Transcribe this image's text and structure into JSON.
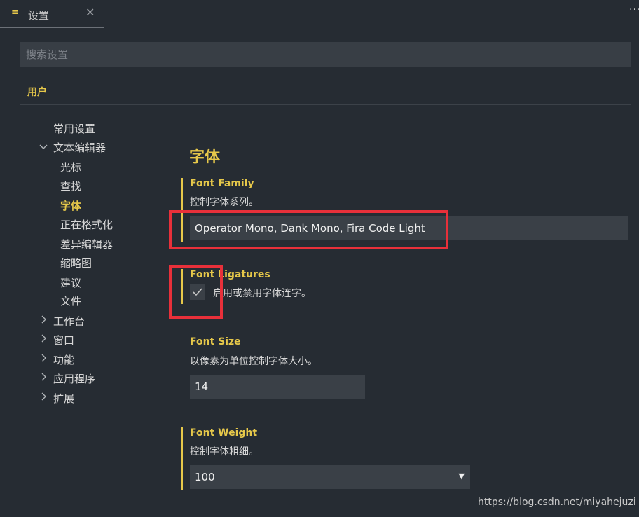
{
  "tab": {
    "label": "设置",
    "icon": "settings-list-icon",
    "close_glyph": "✕"
  },
  "toolbar": {
    "more_glyph": "···"
  },
  "search": {
    "placeholder": "搜索设置",
    "value": ""
  },
  "scope": {
    "label": "用户"
  },
  "toc": {
    "items": [
      {
        "label": "常用设置"
      },
      {
        "label": "文本编辑器",
        "expanded": true
      },
      {
        "label": "光标"
      },
      {
        "label": "查找"
      },
      {
        "label": "字体",
        "active": true
      },
      {
        "label": "正在格式化"
      },
      {
        "label": "差异编辑器"
      },
      {
        "label": "缩略图"
      },
      {
        "label": "建议"
      },
      {
        "label": "文件"
      },
      {
        "label": "工作台",
        "expanded": false
      },
      {
        "label": "窗口",
        "expanded": false
      },
      {
        "label": "功能",
        "expanded": false
      },
      {
        "label": "应用程序",
        "expanded": false
      },
      {
        "label": "扩展",
        "expanded": false
      }
    ]
  },
  "section": {
    "title": "字体"
  },
  "settings": {
    "font_family": {
      "title": "Font Family",
      "description": "控制字体系列。",
      "value": "Operator Mono, Dank Mono, Fira Code Light"
    },
    "font_ligatures": {
      "title": "Font Ligatures",
      "description": "启用或禁用字体连字。",
      "checked": true
    },
    "font_size": {
      "title": "Font Size",
      "description": "以像素为单位控制字体大小。",
      "value": "14"
    },
    "font_weight": {
      "title": "Font Weight",
      "description": "控制字体粗细。",
      "value": "100"
    }
  },
  "watermark": {
    "text": "https://blog.csdn.net/miyahejuzi"
  },
  "colors": {
    "background": "#262c33",
    "accent": "#e6c84a",
    "input_bg": "#3a4047",
    "annotation": "#e8303a"
  }
}
